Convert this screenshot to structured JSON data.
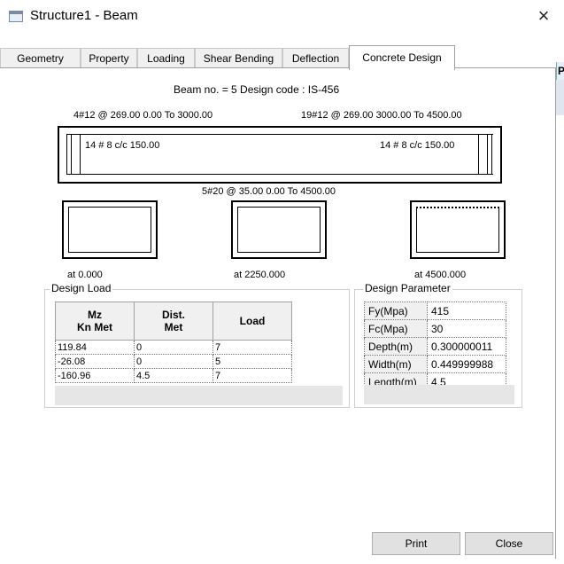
{
  "window": {
    "title": "Structure1 - Beam",
    "close_glyph": "×"
  },
  "tabs": [
    {
      "label": "Geometry"
    },
    {
      "label": "Property"
    },
    {
      "label": "Loading"
    },
    {
      "label": "Shear Bending"
    },
    {
      "label": "Deflection"
    },
    {
      "label": "Concrete Design",
      "active": true
    }
  ],
  "edge_text": "P",
  "header": {
    "beam_line": "Beam no. = 5  Design code :  IS-456"
  },
  "beam": {
    "top_left_rebar": "4#12 @ 269.00 0.00 To 3000.00",
    "top_right_rebar": "19#12 @ 269.00 3000.00 To 4500.00",
    "stirrup_left": "14 # 8 c/c 150.00",
    "stirrup_right": "14 # 8 c/c 150.00",
    "bottom_rebar": "5#20 @ 35.00 0.00 To 4500.00"
  },
  "sections": [
    {
      "label": "at 0.000"
    },
    {
      "label": "at 2250.000"
    },
    {
      "label": "at 4500.000"
    }
  ],
  "design_load": {
    "title": "Design Load",
    "headers": [
      {
        "l1": "Mz",
        "l2": "Kn Met"
      },
      {
        "l1": "Dist.",
        "l2": "Met"
      },
      {
        "l1": "Load",
        "l2": ""
      }
    ],
    "rows": [
      [
        "119.84",
        "0",
        "7"
      ],
      [
        "-26.08",
        "0",
        "5"
      ],
      [
        "-160.96",
        "4.5",
        "7"
      ]
    ]
  },
  "design_parameter": {
    "title": "Design Parameter",
    "rows": [
      [
        "Fy(Mpa)",
        "415"
      ],
      [
        "Fc(Mpa)",
        "30"
      ],
      [
        "Depth(m)",
        "0.300000011"
      ],
      [
        "Width(m)",
        "0.449999988"
      ],
      [
        "Length(m)",
        "4.5"
      ]
    ]
  },
  "buttons": {
    "print": "Print",
    "close": "Close"
  },
  "colors": {
    "tab_bg": "#f0f0f0",
    "panel_bg": "#ffffff",
    "button_bg": "#e1e1e1",
    "table_fill": "#e6e6e6"
  }
}
